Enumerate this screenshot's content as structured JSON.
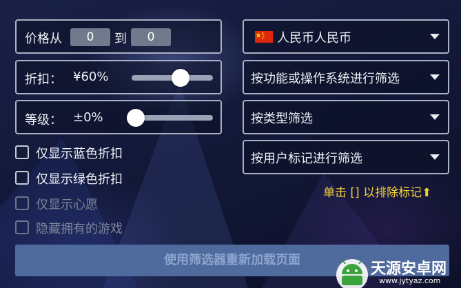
{
  "price": {
    "from_label": "价格从",
    "from_value": "0",
    "to_label": "到",
    "to_value": "0"
  },
  "discount": {
    "label": "折扣：",
    "value": "¥60%",
    "level": 0.6
  },
  "rating": {
    "label": "等级：",
    "value": "±0%",
    "level": 0.05
  },
  "checkboxes": [
    {
      "label": "仅显示蓝色折扣",
      "checked": false,
      "enabled": true
    },
    {
      "label": "仅显示绿色折扣",
      "checked": false,
      "enabled": true
    },
    {
      "label": "仅显示心愿",
      "checked": false,
      "enabled": false
    },
    {
      "label": "隐藏拥有的游戏",
      "checked": false,
      "enabled": false
    }
  ],
  "dropdowns": {
    "currency": "人民币人民币",
    "platform": "按功能或操作系统进行筛选",
    "type": "按类型筛选",
    "user_tags": "按用户标记进行筛选"
  },
  "hint": "单击 [] 以排除标记",
  "reload_button": "使用筛选器重新加载页面",
  "watermark": {
    "name": "天源安卓网",
    "url": "www.jytyaz.com"
  },
  "colors": {
    "accent_yellow": "#f3d03a",
    "button_blue": "#4f6b9d",
    "flag_red": "#de2910"
  }
}
